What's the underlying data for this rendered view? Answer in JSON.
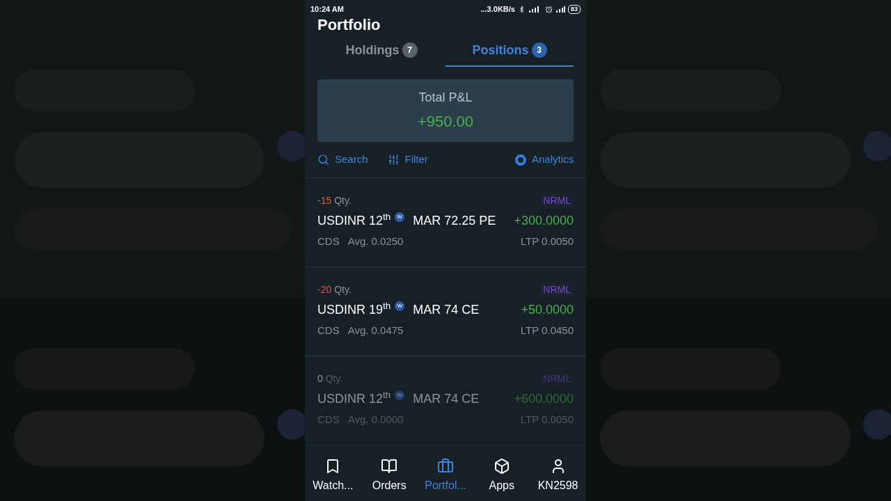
{
  "status_bar": {
    "time": "10:24 AM",
    "speed": "...3.0KB/s",
    "battery": "83"
  },
  "title": "Portfolio",
  "tabs": [
    {
      "label": "Holdings",
      "count": "7",
      "selected": false
    },
    {
      "label": "Positions",
      "count": "3",
      "selected": true
    }
  ],
  "summary": {
    "label": "Total P&L",
    "value": "+950.00"
  },
  "toolbar": {
    "search": "Search",
    "filter": "Filter",
    "analytics": "Analytics"
  },
  "positions": [
    {
      "qty": "-15",
      "qty_label": "Qty.",
      "product": "NRML",
      "name": "USDINR 12$^{th}$",
      "badge": "W",
      "contract": "MAR 72.25 PE",
      "pnl": "+300.0000",
      "exchange": "CDS",
      "avg": "Avg. 0.0250",
      "ltp": "LTP 0.0050",
      "closed": false
    },
    {
      "qty": "-20",
      "qty_label": "Qty.",
      "product": "NRML",
      "name": "USDINR 19$^{th}$",
      "badge": "W",
      "contract": "MAR 74 CE",
      "pnl": "+50.0000",
      "exchange": "CDS",
      "avg": "Avg. 0.0475",
      "ltp": "LTP 0.0450",
      "closed": false
    },
    {
      "qty": "0",
      "qty_label": "Qty.",
      "product": "NRML",
      "name": "USDINR 12$^{th}$",
      "badge": "W",
      "contract": "MAR 74 CE",
      "pnl": "+600.0000",
      "exchange": "CDS",
      "avg": "Avg. 0.0000",
      "ltp": "LTP 0.0050",
      "closed": true
    }
  ],
  "nav": [
    {
      "label": "Watch...",
      "selected": false
    },
    {
      "label": "Orders",
      "selected": false
    },
    {
      "label": "Portfol...",
      "selected": true
    },
    {
      "label": "Apps",
      "selected": false
    },
    {
      "label": "KN2598",
      "selected": false
    }
  ]
}
